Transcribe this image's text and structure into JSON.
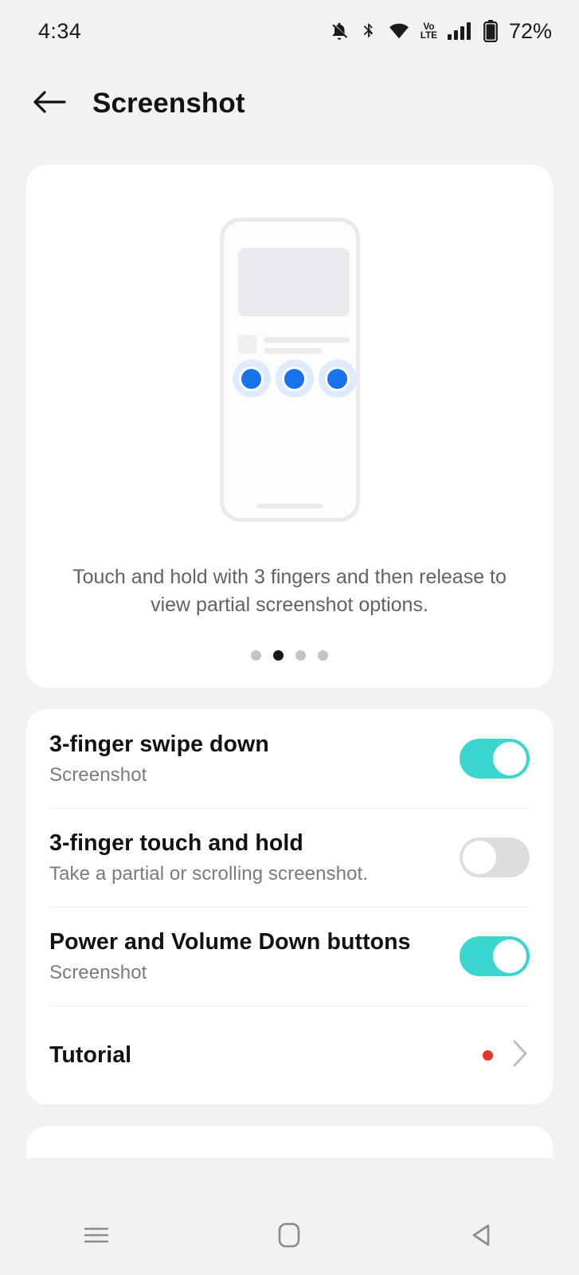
{
  "status_bar": {
    "time": "4:34",
    "battery_percent": "72%",
    "icons": [
      "bell-off-icon",
      "bluetooth-icon",
      "wifi-icon",
      "volte-icon",
      "signal-bars-icon",
      "battery-icon"
    ],
    "volte_top": "Vo",
    "volte_bottom": "LTE"
  },
  "header": {
    "back_icon": "arrow-left-icon",
    "title": "Screenshot"
  },
  "illustration": {
    "caption": "Touch and hold with 3 fingers and then release to view partial screenshot options.",
    "pager": {
      "count": 4,
      "active_index": 1
    },
    "finger_dot_count": 3,
    "colors": {
      "finger_dot": "#1673ec",
      "finger_halo": "#ddeaff",
      "placeholder": "#eaebee"
    }
  },
  "settings": {
    "rows": [
      {
        "title": "3-finger swipe down",
        "subtitle": "Screenshot",
        "control": "toggle",
        "state": "on"
      },
      {
        "title": "3-finger touch and hold",
        "subtitle": "Take a partial or scrolling screenshot.",
        "control": "toggle",
        "state": "off"
      },
      {
        "title": "Power and Volume Down buttons",
        "subtitle": "Screenshot",
        "control": "toggle",
        "state": "on"
      },
      {
        "title": "Tutorial",
        "subtitle": "",
        "control": "chevron",
        "badge": "new",
        "state": ""
      }
    ],
    "colors": {
      "toggle_on": "#3ad6ce",
      "toggle_off": "#dddddd",
      "badge_dot": "#e0372a"
    }
  },
  "nav_bar": {
    "items": [
      {
        "name": "recents-button",
        "icon": "menu-icon"
      },
      {
        "name": "home-button",
        "icon": "home-square-icon"
      },
      {
        "name": "back-button",
        "icon": "triangle-back-icon"
      }
    ]
  }
}
